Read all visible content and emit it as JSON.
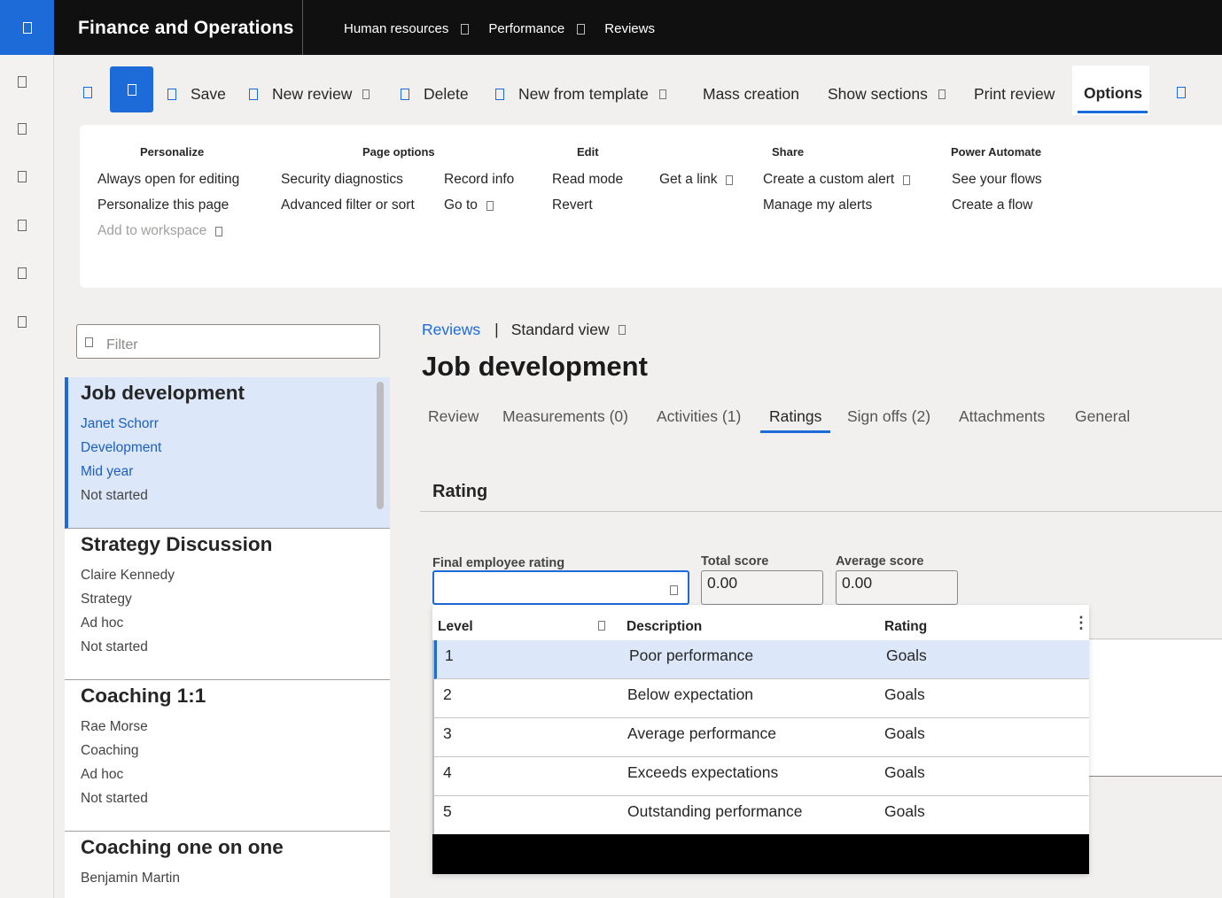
{
  "topbar": {
    "app_title": "Finance and Operations",
    "breadcrumbs": [
      "Human resources",
      "Performance",
      "Reviews"
    ]
  },
  "action_pane": {
    "save": "Save",
    "new_review": "New review",
    "delete": "Delete",
    "new_from_template": "New from template",
    "mass_creation": "Mass creation",
    "show_sections": "Show sections",
    "print_review": "Print review",
    "options": "Options"
  },
  "ribbon": {
    "personalize": {
      "header": "Personalize",
      "items": [
        "Always open for editing",
        "Personalize this page",
        "Add to workspace"
      ]
    },
    "page_options": {
      "header": "Page options",
      "items": [
        "Security diagnostics",
        "Advanced filter or sort",
        "Record info",
        "Go to"
      ]
    },
    "edit": {
      "header": "Edit",
      "items": [
        "Read mode",
        "Revert"
      ]
    },
    "get_link": "Get a link",
    "share": {
      "header": "Share",
      "items": [
        "Create a custom alert",
        "Manage my alerts"
      ]
    },
    "power_automate": {
      "header": "Power Automate",
      "items": [
        "See your flows",
        "Create a flow"
      ]
    }
  },
  "filter": {
    "placeholder": "Filter"
  },
  "list": [
    {
      "title": "Job development",
      "lines": [
        "Janet Schorr",
        "Development",
        "Mid year",
        "Not started"
      ]
    },
    {
      "title": "Strategy Discussion",
      "lines": [
        "Claire Kennedy",
        "Strategy",
        "Ad hoc",
        "Not started"
      ]
    },
    {
      "title": "Coaching 1:1",
      "lines": [
        "Rae Morse",
        "Coaching",
        "Ad hoc",
        "Not started"
      ]
    },
    {
      "title": "Coaching one on one",
      "lines": [
        "Benjamin Martin"
      ]
    }
  ],
  "detail": {
    "breadcrumb_link": "Reviews",
    "breadcrumb_sep": "|",
    "view": "Standard view",
    "title": "Job development",
    "tabs": [
      "Review",
      "Measurements (0)",
      "Activities (1)",
      "Ratings",
      "Sign offs (2)",
      "Attachments",
      "General"
    ],
    "active_tab": "Ratings",
    "section": "Rating",
    "final_rating_label": "Final employee rating",
    "final_rating_value": "",
    "total_score_label": "Total score",
    "total_score": "0.00",
    "average_score_label": "Average score",
    "average_score": "0.00"
  },
  "lookup": {
    "columns": [
      "Level",
      "Description",
      "Rating"
    ],
    "more": "⋮",
    "rows": [
      {
        "level": "1",
        "description": "Poor performance",
        "rating": "Goals"
      },
      {
        "level": "2",
        "description": "Below expectation",
        "rating": "Goals"
      },
      {
        "level": "3",
        "description": "Average performance",
        "rating": "Goals"
      },
      {
        "level": "4",
        "description": "Exceeds expectations",
        "rating": "Goals"
      },
      {
        "level": "5",
        "description": "Outstanding performance",
        "rating": "Goals"
      }
    ]
  },
  "colors": {
    "accent": "#1c6bd8",
    "topbar": "#101010",
    "selected_row": "#dce8fa"
  }
}
